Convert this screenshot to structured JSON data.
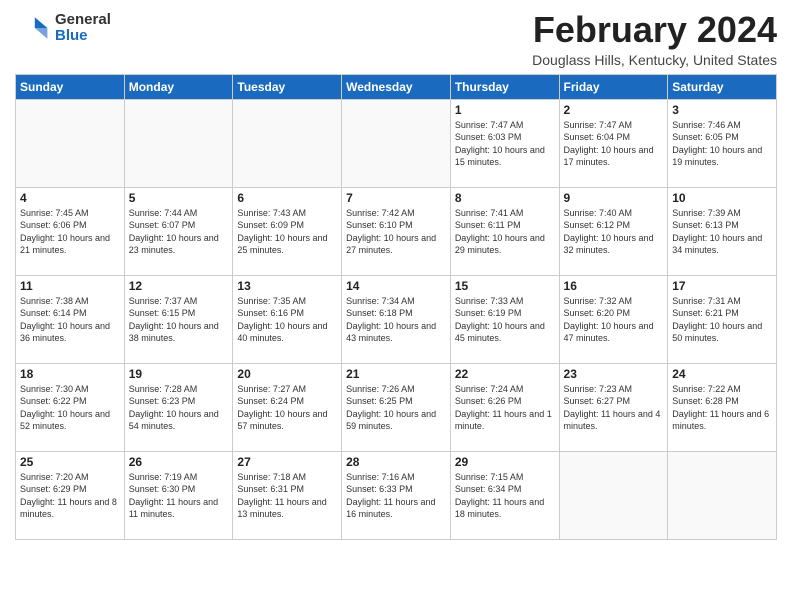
{
  "header": {
    "logo_general": "General",
    "logo_blue": "Blue",
    "title": "February 2024",
    "location": "Douglass Hills, Kentucky, United States"
  },
  "weekdays": [
    "Sunday",
    "Monday",
    "Tuesday",
    "Wednesday",
    "Thursday",
    "Friday",
    "Saturday"
  ],
  "weeks": [
    [
      {
        "day": "",
        "info": ""
      },
      {
        "day": "",
        "info": ""
      },
      {
        "day": "",
        "info": ""
      },
      {
        "day": "",
        "info": ""
      },
      {
        "day": "1",
        "info": "Sunrise: 7:47 AM\nSunset: 6:03 PM\nDaylight: 10 hours\nand 15 minutes."
      },
      {
        "day": "2",
        "info": "Sunrise: 7:47 AM\nSunset: 6:04 PM\nDaylight: 10 hours\nand 17 minutes."
      },
      {
        "day": "3",
        "info": "Sunrise: 7:46 AM\nSunset: 6:05 PM\nDaylight: 10 hours\nand 19 minutes."
      }
    ],
    [
      {
        "day": "4",
        "info": "Sunrise: 7:45 AM\nSunset: 6:06 PM\nDaylight: 10 hours\nand 21 minutes."
      },
      {
        "day": "5",
        "info": "Sunrise: 7:44 AM\nSunset: 6:07 PM\nDaylight: 10 hours\nand 23 minutes."
      },
      {
        "day": "6",
        "info": "Sunrise: 7:43 AM\nSunset: 6:09 PM\nDaylight: 10 hours\nand 25 minutes."
      },
      {
        "day": "7",
        "info": "Sunrise: 7:42 AM\nSunset: 6:10 PM\nDaylight: 10 hours\nand 27 minutes."
      },
      {
        "day": "8",
        "info": "Sunrise: 7:41 AM\nSunset: 6:11 PM\nDaylight: 10 hours\nand 29 minutes."
      },
      {
        "day": "9",
        "info": "Sunrise: 7:40 AM\nSunset: 6:12 PM\nDaylight: 10 hours\nand 32 minutes."
      },
      {
        "day": "10",
        "info": "Sunrise: 7:39 AM\nSunset: 6:13 PM\nDaylight: 10 hours\nand 34 minutes."
      }
    ],
    [
      {
        "day": "11",
        "info": "Sunrise: 7:38 AM\nSunset: 6:14 PM\nDaylight: 10 hours\nand 36 minutes."
      },
      {
        "day": "12",
        "info": "Sunrise: 7:37 AM\nSunset: 6:15 PM\nDaylight: 10 hours\nand 38 minutes."
      },
      {
        "day": "13",
        "info": "Sunrise: 7:35 AM\nSunset: 6:16 PM\nDaylight: 10 hours\nand 40 minutes."
      },
      {
        "day": "14",
        "info": "Sunrise: 7:34 AM\nSunset: 6:18 PM\nDaylight: 10 hours\nand 43 minutes."
      },
      {
        "day": "15",
        "info": "Sunrise: 7:33 AM\nSunset: 6:19 PM\nDaylight: 10 hours\nand 45 minutes."
      },
      {
        "day": "16",
        "info": "Sunrise: 7:32 AM\nSunset: 6:20 PM\nDaylight: 10 hours\nand 47 minutes."
      },
      {
        "day": "17",
        "info": "Sunrise: 7:31 AM\nSunset: 6:21 PM\nDaylight: 10 hours\nand 50 minutes."
      }
    ],
    [
      {
        "day": "18",
        "info": "Sunrise: 7:30 AM\nSunset: 6:22 PM\nDaylight: 10 hours\nand 52 minutes."
      },
      {
        "day": "19",
        "info": "Sunrise: 7:28 AM\nSunset: 6:23 PM\nDaylight: 10 hours\nand 54 minutes."
      },
      {
        "day": "20",
        "info": "Sunrise: 7:27 AM\nSunset: 6:24 PM\nDaylight: 10 hours\nand 57 minutes."
      },
      {
        "day": "21",
        "info": "Sunrise: 7:26 AM\nSunset: 6:25 PM\nDaylight: 10 hours\nand 59 minutes."
      },
      {
        "day": "22",
        "info": "Sunrise: 7:24 AM\nSunset: 6:26 PM\nDaylight: 11 hours\nand 1 minute."
      },
      {
        "day": "23",
        "info": "Sunrise: 7:23 AM\nSunset: 6:27 PM\nDaylight: 11 hours\nand 4 minutes."
      },
      {
        "day": "24",
        "info": "Sunrise: 7:22 AM\nSunset: 6:28 PM\nDaylight: 11 hours\nand 6 minutes."
      }
    ],
    [
      {
        "day": "25",
        "info": "Sunrise: 7:20 AM\nSunset: 6:29 PM\nDaylight: 11 hours\nand 8 minutes."
      },
      {
        "day": "26",
        "info": "Sunrise: 7:19 AM\nSunset: 6:30 PM\nDaylight: 11 hours\nand 11 minutes."
      },
      {
        "day": "27",
        "info": "Sunrise: 7:18 AM\nSunset: 6:31 PM\nDaylight: 11 hours\nand 13 minutes."
      },
      {
        "day": "28",
        "info": "Sunrise: 7:16 AM\nSunset: 6:33 PM\nDaylight: 11 hours\nand 16 minutes."
      },
      {
        "day": "29",
        "info": "Sunrise: 7:15 AM\nSunset: 6:34 PM\nDaylight: 11 hours\nand 18 minutes."
      },
      {
        "day": "",
        "info": ""
      },
      {
        "day": "",
        "info": ""
      }
    ]
  ]
}
